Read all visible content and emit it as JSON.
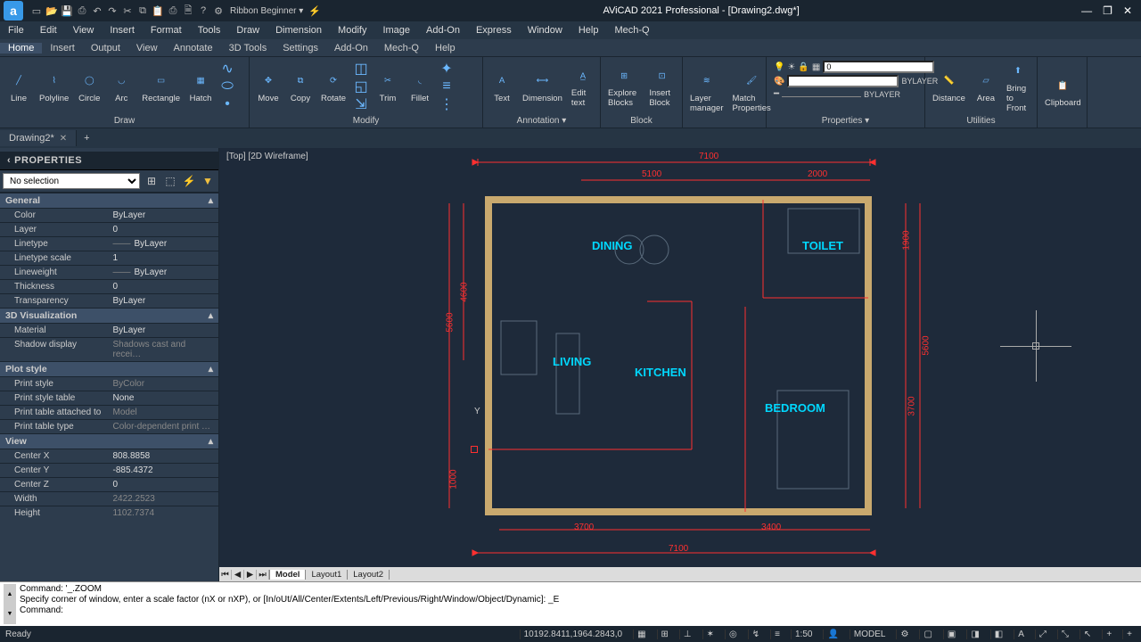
{
  "app": {
    "title": "AViCAD 2021 Professional - [Drawing2.dwg*]",
    "logo": "a"
  },
  "workspace_combo": "Ribbon Beginner",
  "menu": [
    "File",
    "Edit",
    "View",
    "Insert",
    "Format",
    "Tools",
    "Draw",
    "Dimension",
    "Modify",
    "Image",
    "Add-On",
    "Express",
    "Window",
    "Help",
    "Mech-Q"
  ],
  "submenu": [
    "Home",
    "Insert",
    "Output",
    "View",
    "Annotate",
    "3D Tools",
    "Settings",
    "Add-On",
    "Mech-Q",
    "Help"
  ],
  "ribbon": {
    "draw": [
      "Line",
      "Polyline",
      "Circle",
      "Arc",
      "Rectangle",
      "Hatch"
    ],
    "modify": [
      "Move",
      "Copy",
      "Rotate",
      "",
      "Trim",
      "Fillet"
    ],
    "annotation": [
      "Text",
      "Dimension",
      "Edit text"
    ],
    "block": [
      "Explore Blocks",
      "Insert Block"
    ],
    "layer": [
      "Layer manager",
      "Match Properties"
    ],
    "utilities": [
      "Distance",
      "Area",
      "Bring to Front"
    ],
    "clipboard": [
      "Clipboard"
    ],
    "props_num": "0",
    "props_layer1": "BYLAYER",
    "props_layer2": "BYLAYER",
    "groups": {
      "draw": "Draw",
      "modify": "Modify",
      "annotation": "Annotation",
      "block": "Block",
      "properties": "Properties",
      "utilities": "Utilities"
    }
  },
  "tabs": {
    "current": "Drawing2*"
  },
  "properties": {
    "title": "PROPERTIES",
    "selection": "No selection",
    "sections": {
      "general": {
        "label": "General",
        "rows": [
          {
            "k": "Color",
            "v": "ByLayer"
          },
          {
            "k": "Layer",
            "v": "0"
          },
          {
            "k": "Linetype",
            "v": "ByLayer",
            "pre": "——"
          },
          {
            "k": "Linetype scale",
            "v": "1"
          },
          {
            "k": "Lineweight",
            "v": "ByLayer",
            "pre": "——"
          },
          {
            "k": "Thickness",
            "v": "0"
          },
          {
            "k": "Transparency",
            "v": "ByLayer"
          }
        ]
      },
      "viz3d": {
        "label": "3D Visualization",
        "rows": [
          {
            "k": "Material",
            "v": "ByLayer"
          },
          {
            "k": "Shadow display",
            "v": "Shadows cast and recei…",
            "muted": true
          }
        ]
      },
      "plot": {
        "label": "Plot style",
        "rows": [
          {
            "k": "Print style",
            "v": "ByColor",
            "muted": true
          },
          {
            "k": "Print style table",
            "v": "None"
          },
          {
            "k": "Print table attached to",
            "v": "Model",
            "muted": true
          },
          {
            "k": "Print table type",
            "v": "Color-dependent print …",
            "muted": true
          }
        ]
      },
      "view": {
        "label": "View",
        "rows": [
          {
            "k": "Center X",
            "v": "808.8858"
          },
          {
            "k": "Center Y",
            "v": "-885.4372"
          },
          {
            "k": "Center Z",
            "v": "0"
          },
          {
            "k": "Width",
            "v": "2422.2523",
            "muted": true
          },
          {
            "k": "Height",
            "v": "1102.7374",
            "muted": true
          }
        ]
      }
    }
  },
  "viewport_label": "[Top] [2D Wireframe]",
  "rooms": {
    "dining": "DINING",
    "toilet": "TOILET",
    "living": "LIVING",
    "kitchen": "KITCHEN",
    "bedroom": "BEDROOM"
  },
  "dims": {
    "d7100t": "7100",
    "d5100": "5100",
    "d2000": "2000",
    "d1900": "1900",
    "d5600l": "5600",
    "d4600": "4600",
    "d5600r": "5600",
    "d3700r": "3700",
    "d1000": "1000",
    "d3700b": "3700",
    "d3400": "3400",
    "d7100b": "7100"
  },
  "model_tabs": [
    "Model",
    "Layout1",
    "Layout2"
  ],
  "cmd": {
    "line1": "Command: '_.ZOOM",
    "line2": "Specify corner of window, enter a scale factor (nX or nXP), or [In/oUt/All/Center/Extents/Left/Previous/Right/Window/Object/Dynamic]: _E",
    "line3": "Command:"
  },
  "status": {
    "ready": "Ready",
    "coords": "10192.8411,1964.2843,0",
    "scale": "1:50",
    "model": "MODEL"
  },
  "ucs_label": "Y"
}
